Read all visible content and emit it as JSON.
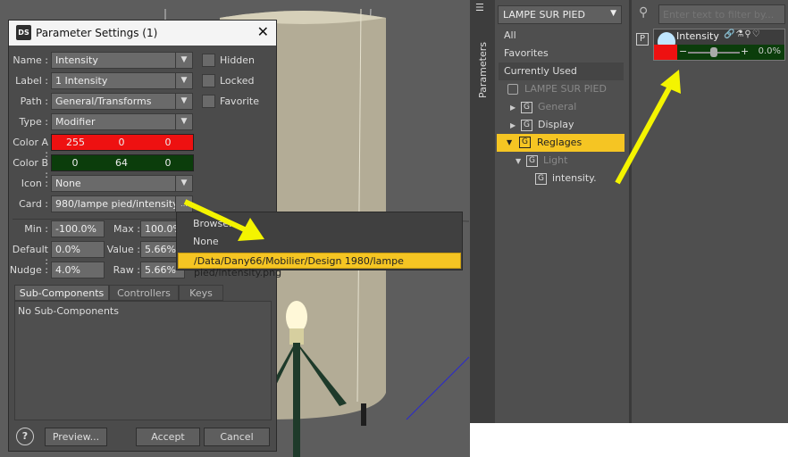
{
  "dialog": {
    "title": "Parameter Settings (1)",
    "logo": "DS",
    "name_label": "Name :",
    "name_value": "Intensity",
    "label_label": "Label :",
    "label_value": "1 Intensity",
    "path_label": "Path :",
    "path_value": "General/Transforms",
    "type_label": "Type :",
    "type_value": "Modifier",
    "colorA_label": "Color A :",
    "colorA": [
      "255",
      "0",
      "0"
    ],
    "colorB_label": "Color B :",
    "colorB": [
      "0",
      "64",
      "0"
    ],
    "icon_label": "Icon :",
    "icon_value": "None",
    "card_label": "Card :",
    "card_value": "980/lampe pied/intensity.png",
    "hidden": "Hidden",
    "locked": "Locked",
    "favorite": "Favorite",
    "min_label": "Min :",
    "min_value": "-100.0%",
    "max_label": "Max :",
    "max_value": "100.0%",
    "default_label": "Default :",
    "default_value": "0.0%",
    "value_label": "Value :",
    "value_value": "5.66%",
    "nudge_label": "Nudge :",
    "nudge_value": "4.0%",
    "raw_label": "Raw :",
    "raw_value": "5.66%",
    "tabs": [
      "Sub-Components",
      "Controllers",
      "Keys"
    ],
    "subcomp_text": "No Sub-Components",
    "help": "?",
    "preview": "Preview...",
    "accept": "Accept",
    "cancel": "Cancel"
  },
  "popup": {
    "items": [
      "Browse...",
      "None",
      "/Data/Dany66/Mobilier/Design 1980/lampe pied/intensity.png"
    ]
  },
  "panel": {
    "tab_label": "Parameters",
    "node_select": "LAMPE SUR PIED",
    "filter_placeholder": "Enter text to filter by...",
    "list": [
      "All",
      "Favorites",
      "Currently Used"
    ],
    "tree": {
      "root": "LAMPE SUR PIED",
      "general": "General",
      "display": "Display",
      "reglages": "Reglages",
      "light": "Light",
      "intensity": "intensity."
    },
    "param": {
      "name": "Intensity",
      "minus": "−",
      "plus": "+",
      "value": "0.0%",
      "value_fraction": 0.5
    },
    "p_badge": "P"
  },
  "colors": {
    "red": "#ee1111",
    "green": "#0b3d0b",
    "highlight": "#f5c523",
    "arrow": "#f4f400"
  }
}
